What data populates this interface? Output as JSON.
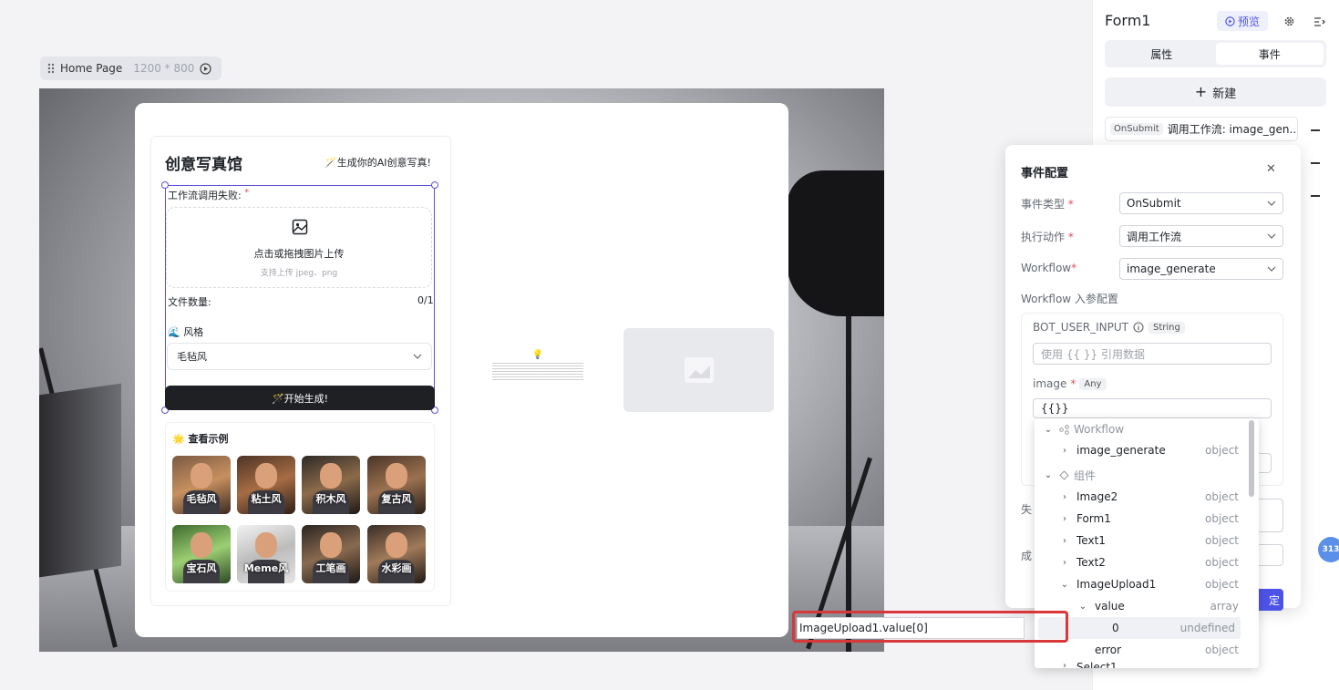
{
  "toolbar": {
    "page_name": "Home Page",
    "dimensions": "1200 * 800"
  },
  "form_card": {
    "title": "创意写真馆",
    "slogan": "🪄生成你的AI创意写真!",
    "upload_label": "工作流调用失败:",
    "required_mark": "*",
    "upload_text": "点击或拖拽图片上传",
    "upload_hint": "支持上传 jpeg、png",
    "file_count_label": "文件数量:",
    "file_count_value": "0/1",
    "style_label": "🌊 风格",
    "style_value": "毛毡风",
    "generate_button": "🪄开始生成!",
    "examples_title": "🌟 查看示例",
    "examples": [
      "毛毡风",
      "粘土风",
      "积木风",
      "复古风",
      "宝石风",
      "Meme风",
      "工笔画",
      "水彩画"
    ]
  },
  "right_panel": {
    "title": "Form1",
    "preview_button": "预览",
    "tabs": [
      "属性",
      "事件"
    ],
    "active_tab": "事件",
    "new_button": "新建",
    "event_tag": "OnSubmit",
    "event_text": "调用工作流: image_gen..."
  },
  "event_config": {
    "title": "事件配置",
    "event_type_label": "事件类型",
    "event_type_value": "OnSubmit",
    "action_label": "执行动作",
    "action_value": "调用工作流",
    "workflow_label": "Workflow",
    "workflow_value": "image_generate",
    "input_config_label": "Workflow 入参配置",
    "bot_input_label": "BOT_USER_INPUT",
    "bot_input_type": "String",
    "bot_input_placeholder": "使用 {{ }} 引用数据",
    "image_label": "image",
    "image_type": "Any",
    "image_value": "{{}}",
    "fail_label_partial": "失",
    "success_label_partial": "成",
    "confirm_partial": "确定"
  },
  "tree": {
    "workflow_group": "Workflow",
    "workflow_item": {
      "name": "image_generate",
      "type": "object"
    },
    "components_group": "组件",
    "components": [
      {
        "name": "Image2",
        "type": "object"
      },
      {
        "name": "Form1",
        "type": "object"
      },
      {
        "name": "Text1",
        "type": "object"
      },
      {
        "name": "Text2",
        "type": "object"
      },
      {
        "name": "ImageUpload1",
        "type": "object"
      }
    ],
    "value_node": {
      "name": "value",
      "type": "array"
    },
    "index_node": {
      "name": "0",
      "type": "undefined"
    },
    "error_node": {
      "name": "error",
      "type": "object"
    },
    "cutoff_row": "Select1"
  },
  "highlight_input": "ImageUpload1.value[0]",
  "badge": "313"
}
